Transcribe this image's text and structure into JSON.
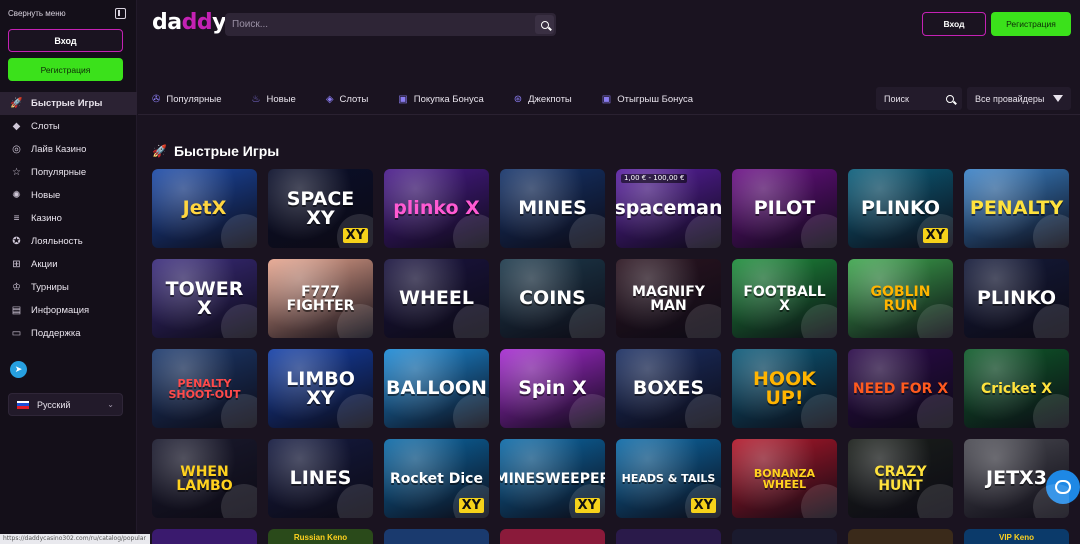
{
  "sidebar": {
    "collapse_label": "Свернуть меню",
    "login_label": "Вход",
    "register_label": "Регистрация",
    "items": [
      {
        "label": "Быстрые Игры",
        "icon": "rocket-icon",
        "active": true
      },
      {
        "label": "Слоты",
        "icon": "diamond-icon"
      },
      {
        "label": "Лайв Казино",
        "icon": "chip-icon"
      },
      {
        "label": "Популярные",
        "icon": "star-icon"
      },
      {
        "label": "Новые",
        "icon": "new-icon"
      },
      {
        "label": "Казино",
        "icon": "coins-icon"
      },
      {
        "label": "Лояльность",
        "icon": "award-icon"
      },
      {
        "label": "Акции",
        "icon": "gift-icon"
      },
      {
        "label": "Турниры",
        "icon": "trophy-icon"
      },
      {
        "label": "Информация",
        "icon": "book-icon"
      },
      {
        "label": "Поддержка",
        "icon": "chat-icon"
      }
    ],
    "language": "Русский"
  },
  "header": {
    "logo_prefix": "da",
    "logo_accent": "dd",
    "logo_suffix": "y",
    "search_placeholder": "Поиск...",
    "login_label": "Вход",
    "register_label": "Регистрация"
  },
  "tabs": [
    {
      "label": "Популярные",
      "icon": "atom-icon"
    },
    {
      "label": "Новые",
      "icon": "flame-icon"
    },
    {
      "label": "Слоты",
      "icon": "gem-icon"
    },
    {
      "label": "Покупка Бонуса",
      "icon": "chest-icon"
    },
    {
      "label": "Джекпоты",
      "icon": "coin-icon"
    },
    {
      "label": "Отыгрыш Бонуса",
      "icon": "chest-icon"
    }
  ],
  "filters": {
    "search_label": "Поиск",
    "providers_label": "Все провайдеры"
  },
  "section_title": "Быстрые Игры",
  "games": [
    {
      "name": "JetX",
      "bg": "#1b4aa8",
      "color": "#ffd640"
    },
    {
      "name": "SPACE XY",
      "bg": "#0a0f2b",
      "color": "#ffffff",
      "xy": true
    },
    {
      "name": "plinko X",
      "bg": "#4a1b8c",
      "color": "#ff5ad3"
    },
    {
      "name": "MINES",
      "bg": "#15346b",
      "color": "#ffffff"
    },
    {
      "name": "spaceman",
      "bg": "#5a1fa3",
      "color": "#ffffff",
      "badge": "1,00 € - 100,00 €"
    },
    {
      "name": "PILOT",
      "bg": "#6b0f86",
      "color": "#ffffff"
    },
    {
      "name": "PLINKO",
      "bg": "#0b5f7c",
      "color": "#ffffff",
      "xy": true
    },
    {
      "name": "PENALTY",
      "bg": "#3a82c8",
      "color": "#ffe23d"
    },
    {
      "name": "TOWER X",
      "bg": "#3a2b7c",
      "color": "#ffffff"
    },
    {
      "name": "F777 FIGHTER",
      "bg": "#e7a58e",
      "color": "#ffffff"
    },
    {
      "name": "WHEEL",
      "bg": "#1a1440",
      "color": "#ffffff"
    },
    {
      "name": "COINS",
      "bg": "#1d3a4c",
      "color": "#ffffff"
    },
    {
      "name": "MAGNIFY MAN",
      "bg": "#2b1420",
      "color": "#ffffff"
    },
    {
      "name": "FOOTBALL X",
      "bg": "#1c8d3a",
      "color": "#ffffff"
    },
    {
      "name": "GOBLIN RUN",
      "bg": "#3da64d",
      "color": "#ffb400"
    },
    {
      "name": "PLINKO",
      "bg": "#141a3a",
      "color": "#ffffff"
    },
    {
      "name": "PENALTY SHOOT-OUT",
      "bg": "#1c3a6e",
      "color": "#ff4a4a"
    },
    {
      "name": "LIMBO XY",
      "bg": "#1440a8",
      "color": "#ffffff"
    },
    {
      "name": "BALLOON",
      "bg": "#1b8ad7",
      "color": "#ffffff"
    },
    {
      "name": "Spin X",
      "bg": "#a62ad1",
      "color": "#ffffff"
    },
    {
      "name": "BOXES",
      "bg": "#1b2f63",
      "color": "#ffffff"
    },
    {
      "name": "HOOK UP!",
      "bg": "#0b5a7a",
      "color": "#ffb400"
    },
    {
      "name": "NEED FOR X",
      "bg": "#2b0a4a",
      "color": "#ff5a1f"
    },
    {
      "name": "Cricket X",
      "bg": "#0e5c2a",
      "color": "#ffe23d"
    },
    {
      "name": "WHEN LAMBO",
      "bg": "#1a1a2e",
      "color": "#ffd21f"
    },
    {
      "name": "LINES",
      "bg": "#141a40",
      "color": "#ffffff"
    },
    {
      "name": "Rocket Dice",
      "bg": "#0b6aa8",
      "color": "#ffffff",
      "xy": true
    },
    {
      "name": "MINESWEEPER",
      "bg": "#0b6aa8",
      "color": "#ffffff",
      "xy": true
    },
    {
      "name": "HEADS & TAILS",
      "bg": "#0b6aa8",
      "color": "#ffffff",
      "xy": true
    },
    {
      "name": "BONANZA WHEEL",
      "bg": "#b3172a",
      "color": "#ffd21f"
    },
    {
      "name": "CRAZY HUNT",
      "bg": "#1a1f1a",
      "color": "#ffe23d"
    },
    {
      "name": "JETX3",
      "bg": "#4a4a52",
      "color": "#ffffff"
    }
  ],
  "partial_games": [
    {
      "bg": "#3a1a6e"
    },
    {
      "bg": "#2a4a1a",
      "name": "Russian Keno"
    },
    {
      "bg": "#1a3a6e"
    },
    {
      "bg": "#8a1a3a"
    },
    {
      "bg": "#2a1a4a"
    },
    {
      "bg": "#1a1a2e"
    },
    {
      "bg": "#3a2a1a"
    },
    {
      "bg": "#0b3a6a",
      "name": "VIP Keno"
    }
  ],
  "status_url": "https://daddycasino302.com/ru/catalog/popular"
}
